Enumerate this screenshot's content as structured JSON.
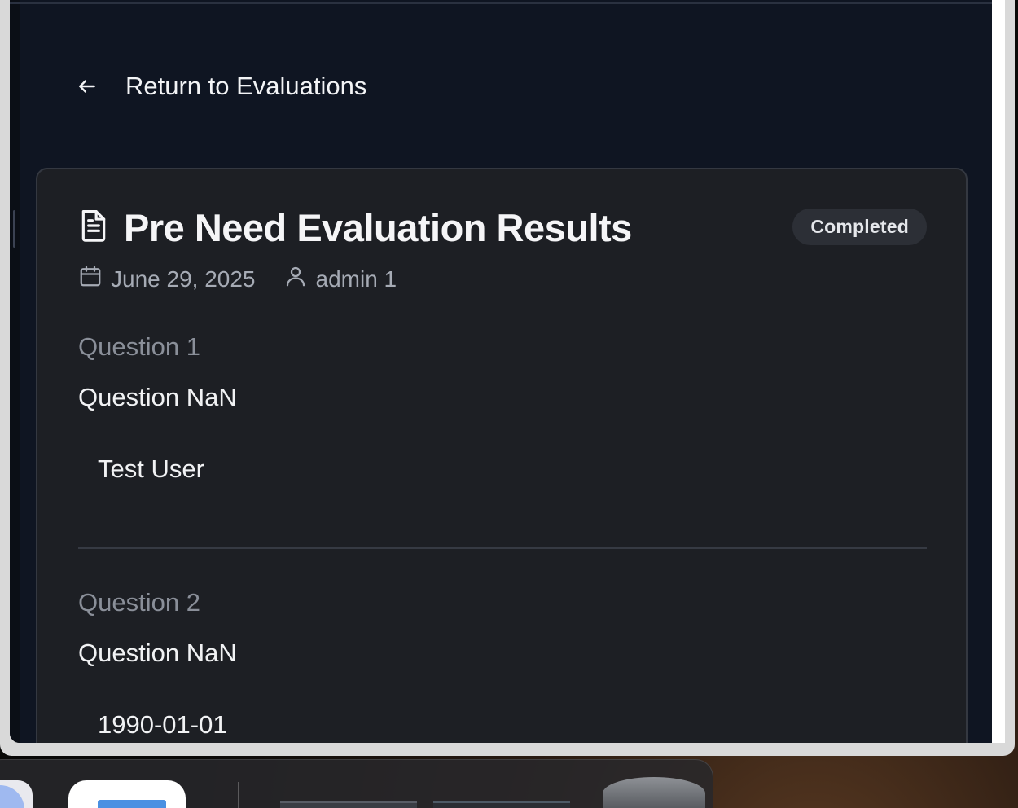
{
  "nav": {
    "back_label": "Return to Evaluations"
  },
  "card": {
    "title": "Pre Need Evaluation Results",
    "status": "Completed",
    "date": "June 29, 2025",
    "author": "admin 1"
  },
  "questions": [
    {
      "label": "Question 1",
      "text": "Question NaN",
      "answer": "Test User"
    },
    {
      "label": "Question 2",
      "text": "Question NaN",
      "answer": "1990-01-01"
    }
  ],
  "icons": {
    "back": "arrow-left-icon",
    "title": "document-icon",
    "date": "calendar-icon",
    "author": "user-icon"
  },
  "colors": {
    "page_bg": "#0f1522",
    "card_bg": "#1d1f24",
    "badge_bg": "#2c2f36"
  }
}
